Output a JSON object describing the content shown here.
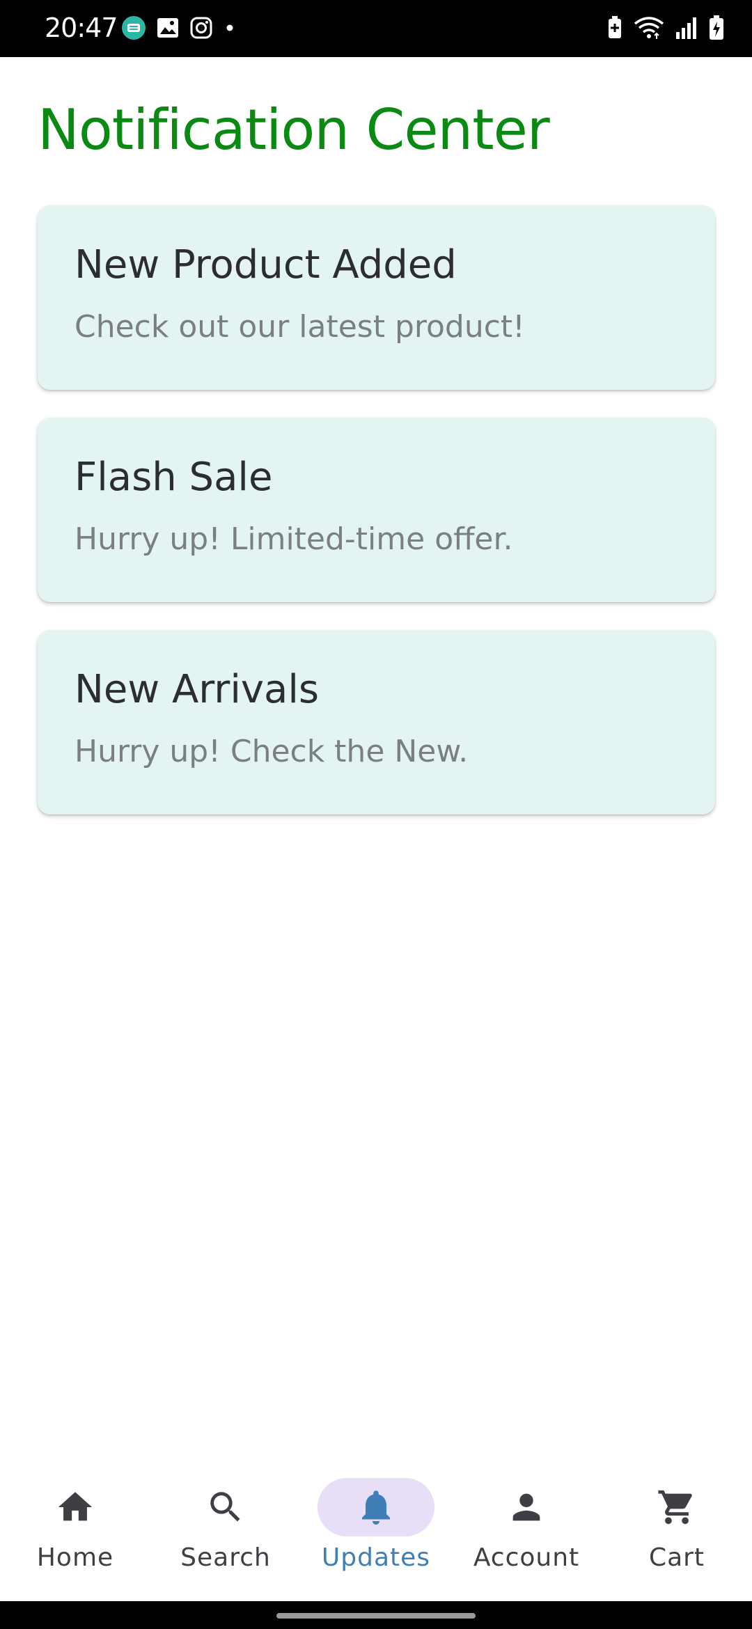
{
  "status_bar": {
    "time": "20:47",
    "left_icons": [
      "app-notification-icon",
      "image-icon",
      "instagram-icon",
      "dot-icon"
    ],
    "right_icons": [
      "battery-saver-icon",
      "wifi-icon",
      "signal-icon",
      "battery-charging-icon"
    ]
  },
  "page": {
    "title": "Notification Center",
    "title_color": "#0a8a12"
  },
  "notifications": [
    {
      "title": "New Product Added",
      "body": "Check out our latest product!"
    },
    {
      "title": "Flash Sale",
      "body": "Hurry up! Limited-time offer."
    },
    {
      "title": "New Arrivals",
      "body": "Hurry up! Check the New."
    }
  ],
  "bottom_nav": {
    "items": [
      {
        "label": "Home",
        "icon": "home-icon",
        "active": false
      },
      {
        "label": "Search",
        "icon": "search-icon",
        "active": false
      },
      {
        "label": "Updates",
        "icon": "bell-icon",
        "active": true
      },
      {
        "label": "Account",
        "icon": "person-icon",
        "active": false
      },
      {
        "label": "Cart",
        "icon": "cart-icon",
        "active": false
      }
    ],
    "active_color": "#3f7fb8",
    "active_pill_color": "#e9def7"
  }
}
